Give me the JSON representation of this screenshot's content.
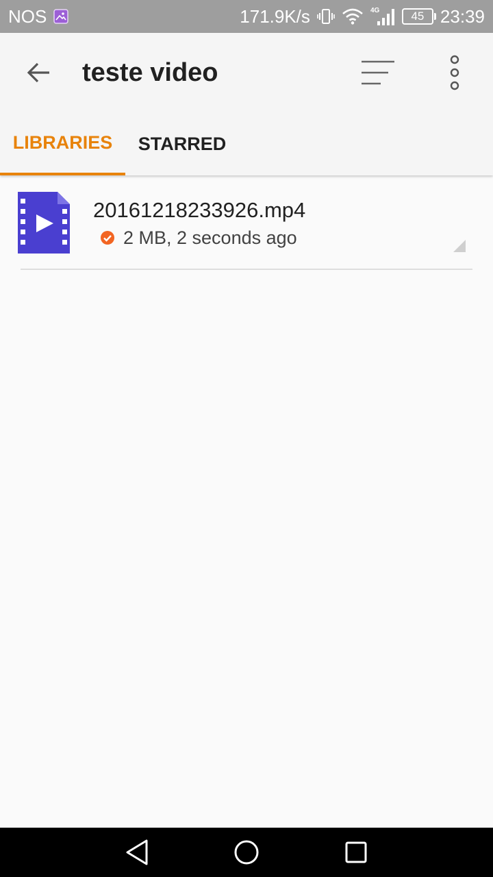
{
  "status_bar": {
    "carrier": "NOS",
    "net_speed": "171.9K/s",
    "network_type": "4G",
    "battery_level": "45",
    "time": "23:39"
  },
  "toolbar": {
    "title": "teste video",
    "back_icon": "arrow-left-icon",
    "sort_icon": "sort-lines-icon",
    "more_icon": "more-vertical-icon"
  },
  "tabs": [
    {
      "label": "LIBRARIES",
      "active": true
    },
    {
      "label": "STARRED",
      "active": false
    }
  ],
  "files": [
    {
      "name": "20161218233926.mp4",
      "meta": "2 MB, 2 seconds ago",
      "icon": "video-file-icon",
      "status_icon": "check-circle-icon"
    }
  ],
  "colors": {
    "accent": "#e8830c",
    "video_icon": "#4a3fd0",
    "status_check": "#f26522",
    "status_bar": "#9e9e9e",
    "app_bar": "#f5f5f5"
  }
}
